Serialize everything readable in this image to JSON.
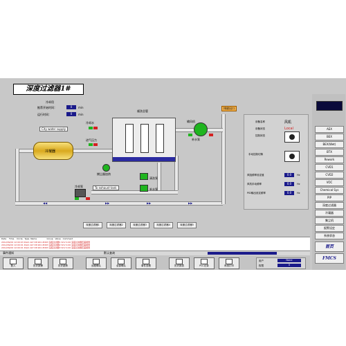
{
  "title": "深度过滤器1#",
  "params": {
    "label1": "冷却用",
    "label2": "推荐开始时间：",
    "label3": "运行时间：",
    "v1": "0",
    "u1": "min",
    "v2": "0",
    "u2": "min"
  },
  "process": {
    "city_water": "City water supply",
    "tank": "冷凝器",
    "filter_top": "顺洗总管",
    "fan_label": "输风机",
    "exhaust": "排放出口",
    "pump1": "冷却水",
    "pump2": "清洗泵",
    "pump3": "补水泵",
    "to_exhaust": "To exhaust tank",
    "spray": "捕尘器加热",
    "motor": "冷却泵",
    "pressure": "进气压力"
  },
  "filter_buttons": [
    "深度过滤器1",
    "深度过滤器2",
    "深度过滤器3",
    "深度过滤器4",
    "深度过滤器5"
  ],
  "right_panel": {
    "dev_name_label": "设备名称",
    "dev_name_value": "风机",
    "dev_state_label": "设备状态",
    "dev_state_value": "Local",
    "ctrl_state_label": "控制状态",
    "manual_label": "手动控制切换",
    "freq_set_label": "风阻频率设定值",
    "freq_manual_label": "风机手动频率",
    "pid_label": "PID输出设定频率",
    "freq_set_value": "0.0",
    "freq_manual_value": "0.0",
    "pid_value": "0.0",
    "unit": "Hz"
  },
  "sidebar": {
    "items": [
      "AEX",
      "BEX",
      "BEX(Wet)",
      "BTX",
      "Rework",
      "CVD1",
      "CVD2",
      "VOC",
      "Chemical Sys",
      "PIP",
      "深度过滤器",
      "冷凝器",
      "集尘机",
      "报警设定",
      "系统状态"
    ],
    "home": "首页",
    "brand": "FMCS"
  },
  "events": {
    "headers": [
      "Date",
      "Time",
      "Circle",
      "Type",
      "Name",
      "Group",
      "Value",
      "Comment"
    ],
    "rows": [
      [
        "2012/09/02",
        "12:00:03",
        "DisCl",
        "ALT",
        "DP-901 ZDR3 深度过滤器1",
        "SCV",
        "0.00",
        "深度过滤器压差报警"
      ],
      [
        "2012/09/02",
        "12:00:01",
        "DisCl",
        "ALT",
        "DP-901 ZDR3 深度过滤器2",
        "SCV",
        "0.00",
        "深度过滤器压差报警"
      ],
      [
        "2012/09/02",
        "12:00:01",
        "DisCl",
        "ALT",
        "DP-901 ZDR3 深度过滤器3",
        "SCV",
        "0.00",
        "深度过滤器压差报警"
      ]
    ]
  },
  "status": {
    "left": "事件通知",
    "mid": "默认查询"
  },
  "toolbar": [
    "登入",
    "历史报警",
    "历史趋势",
    "远程确认",
    "全部确认",
    "事件查看",
    "历史报表",
    "PLC记录",
    "系统打印"
  ],
  "toolbar_right": {
    "user_label": "用户",
    "user_value": "None",
    "level_label": "权限",
    "level_value": "0"
  },
  "colors": {
    "ok": "#1fb51f",
    "alarm": "#d42020",
    "valbox": "#1a1a8a"
  }
}
